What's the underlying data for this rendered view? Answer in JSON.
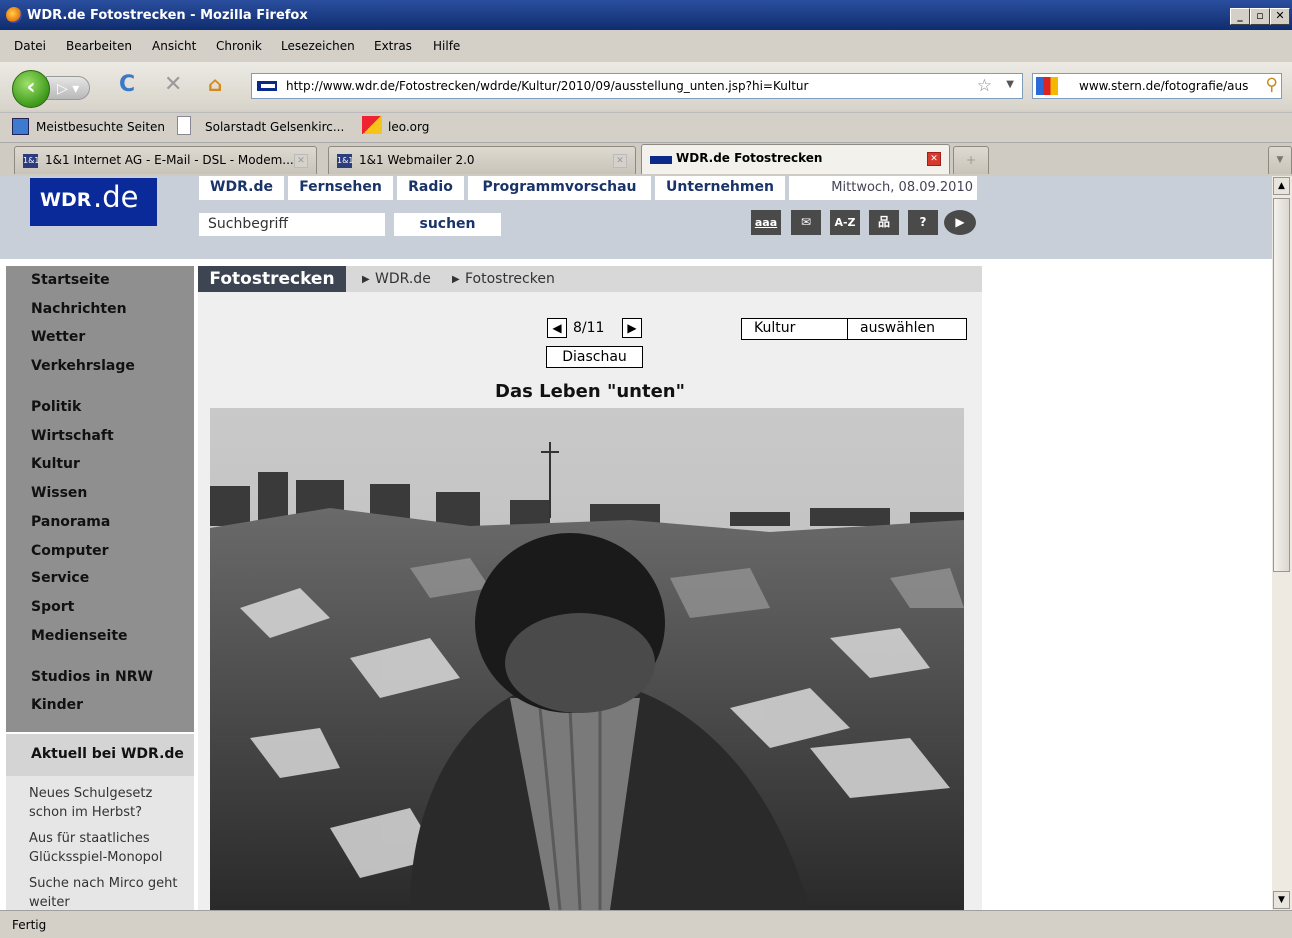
{
  "window": {
    "title": "WDR.de Fotostrecken - Mozilla Firefox"
  },
  "menu": [
    "Datei",
    "Bearbeiten",
    "Ansicht",
    "Chronik",
    "Lesezeichen",
    "Extras",
    "Hilfe"
  ],
  "toolbar": {
    "url": "http://www.wdr.de/Fotostrecken/wdrde/Kultur/2010/09/ausstellung_unten.jsp?hi=Kultur",
    "search": "www.stern.de/fotografie/aus"
  },
  "bookmarks": [
    "Meistbesuchte Seiten",
    "Solarstadt Gelsenkirc...",
    "leo.org"
  ],
  "tabs": [
    {
      "label": "1&1 Internet AG - E-Mail - DSL - Modem...",
      "favicon": "1&1"
    },
    {
      "label": "1&1 Webmailer 2.0",
      "favicon": "1&1"
    },
    {
      "label": "WDR.de Fotostrecken",
      "favicon": "wdr-flag"
    }
  ],
  "site": {
    "logo_a": "WDR",
    "logo_b": ".de",
    "topnav": [
      "WDR.de",
      "Fernsehen",
      "Radio",
      "Programmvorschau",
      "Unternehmen"
    ],
    "date": "Mittwoch, 08.09.2010",
    "search_placeholder": "Suchbegriff",
    "search_button": "suchen",
    "tools": [
      "aaa",
      "✉",
      "A-Z",
      "品",
      "?",
      "▶"
    ]
  },
  "leftnav": {
    "group1": [
      "Startseite",
      "Nachrichten",
      "Wetter",
      "Verkehrslage"
    ],
    "group2": [
      "Politik",
      "Wirtschaft",
      "Kultur",
      "Wissen",
      "Panorama",
      "Computer",
      "Service",
      "Sport",
      "Medienseite"
    ],
    "group3": [
      "Studios in NRW",
      "Kinder"
    ],
    "aktuell_title": "Aktuell bei WDR.de",
    "aktuell": [
      "Neues Schulgesetz schon im Herbst?",
      "Aus für staatliches Glücksspiel-Monopol",
      "Suche nach Mirco geht weiter"
    ]
  },
  "gallery": {
    "section": "Fotostrecken",
    "breadcrumb": [
      "WDR.de",
      "Fotostrecken"
    ],
    "page": "8/11",
    "slideshow": "Diaschau",
    "category": "Kultur",
    "select_button": "auswählen",
    "title": "Das Leben \"unten\""
  },
  "status": "Fertig"
}
